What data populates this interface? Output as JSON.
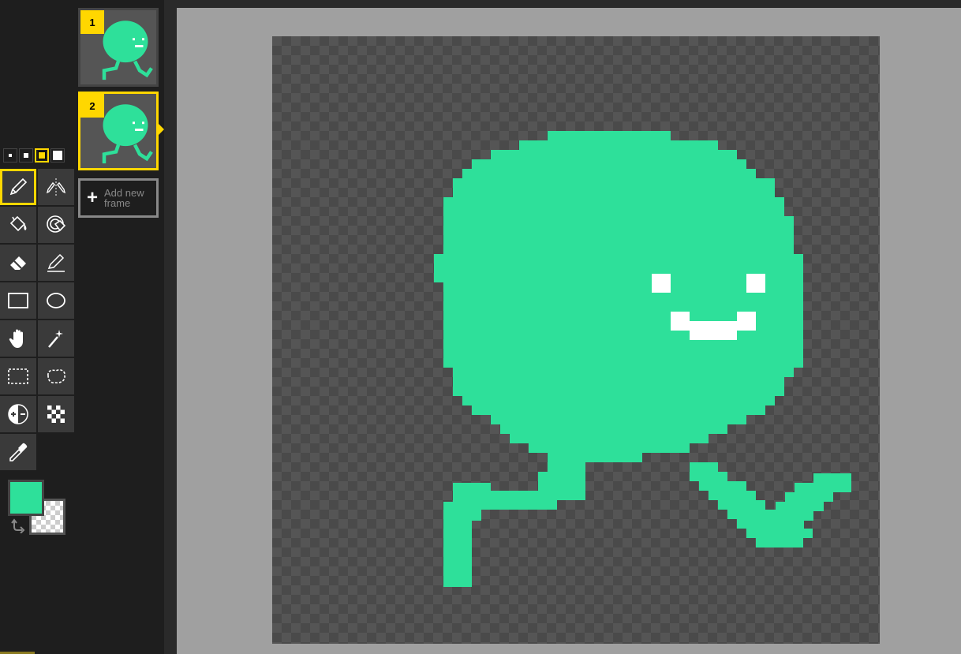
{
  "frames": [
    {
      "number": "1",
      "selected": false
    },
    {
      "number": "2",
      "selected": true
    }
  ],
  "add_frame": {
    "label": "Add new frame"
  },
  "pen_sizes": [
    {
      "size": "1",
      "selected": false
    },
    {
      "size": "2",
      "selected": false
    },
    {
      "size": "3",
      "selected": true
    },
    {
      "size": "4",
      "selected": false
    }
  ],
  "tools": [
    {
      "icon": "pen-icon",
      "selected": true
    },
    {
      "icon": "vertical-mirror-pen-icon",
      "selected": false
    },
    {
      "icon": "paint-bucket-icon",
      "selected": false
    },
    {
      "icon": "paint-all-same-color-icon",
      "selected": false
    },
    {
      "icon": "eraser-icon",
      "selected": false
    },
    {
      "icon": "stroke-icon",
      "selected": false
    },
    {
      "icon": "rectangle-icon",
      "selected": false
    },
    {
      "icon": "circle-icon",
      "selected": false
    },
    {
      "icon": "hand-icon",
      "selected": false
    },
    {
      "icon": "magic-wand-icon",
      "selected": false
    },
    {
      "icon": "rectangle-select-icon",
      "selected": false
    },
    {
      "icon": "lasso-select-icon",
      "selected": false
    },
    {
      "icon": "lighten-darken-icon",
      "selected": false
    },
    {
      "icon": "dithering-icon",
      "selected": false
    },
    {
      "icon": "color-picker-icon",
      "selected": false
    }
  ],
  "colors": {
    "primary": "#2ee09a",
    "secondary": "transparent",
    "accent": "#ffd700"
  }
}
